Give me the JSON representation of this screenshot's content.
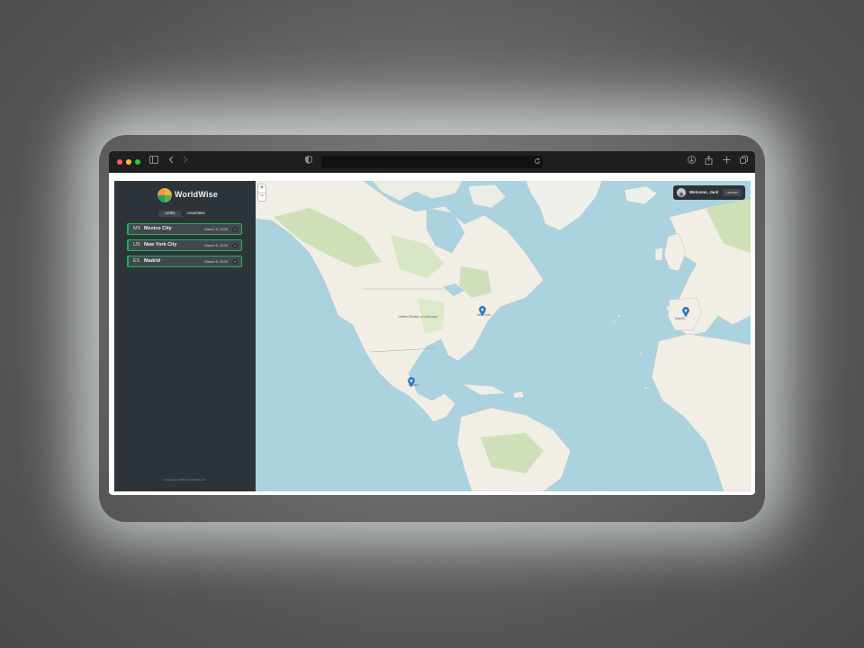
{
  "app": {
    "brand": "WorldWise",
    "tabs": [
      {
        "label": "CITIES",
        "active": false
      },
      {
        "label": "COUNTRIES",
        "active": true
      }
    ],
    "cities": [
      {
        "code": "MX",
        "name": "Mexico City",
        "date": "March 5, 2025",
        "delete": "×"
      },
      {
        "code": "US",
        "name": "New York City",
        "date": "March 6, 2025",
        "delete": "×"
      },
      {
        "code": "ES",
        "name": "Madrid",
        "date": "March 6, 2025",
        "delete": "×"
      }
    ],
    "copyright": "© Copyright 2025 by WorldWise Inc."
  },
  "user": {
    "welcome": "Welcome, Jack",
    "logout": "LOGOUT"
  },
  "map": {
    "zoom_in": "+",
    "zoom_out": "−",
    "labels": {
      "us": "United States of America",
      "mexico": "México",
      "ny": "New York",
      "madrid": "Madrid"
    },
    "markers": [
      "Mexico City",
      "New York City",
      "Madrid"
    ]
  },
  "colors": {
    "accent_green": "#1fb35a",
    "sidebar_bg": "#2d3439",
    "ocean": "#aad3df",
    "marker_blue": "#2a81cb"
  }
}
